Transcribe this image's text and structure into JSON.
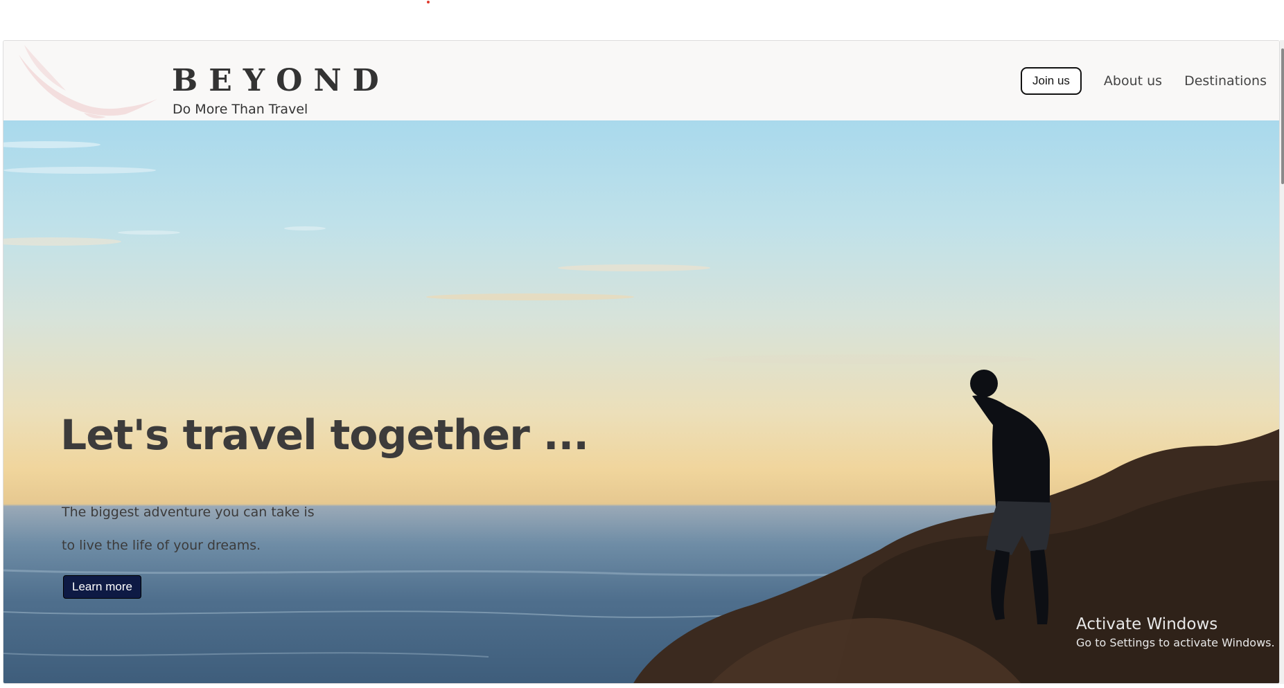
{
  "header": {
    "brand_name": "BEYOND",
    "tagline": "Do More Than Travel",
    "logo_icon": "eagle-icon",
    "nav": {
      "join_label": "Join us",
      "about_label": "About us",
      "destinations_label": "Destinations"
    }
  },
  "hero": {
    "title": "Let's travel together ...",
    "line1": "The biggest adventure you can take is",
    "line2": "to live the life of your dreams.",
    "button_label": "Learn more"
  },
  "overlay": {
    "title": "Activate Windows",
    "subtitle": "Go to Settings to activate Windows."
  },
  "colors": {
    "button_navy": "#0e1a44",
    "text_dark": "#3c3b3b",
    "header_bg": "#f9f8f7"
  }
}
